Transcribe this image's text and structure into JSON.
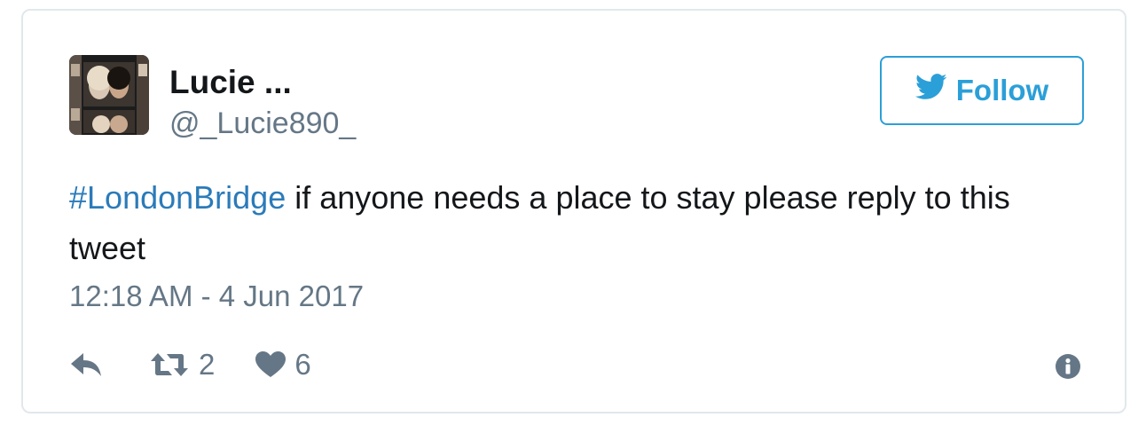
{
  "user": {
    "display_name": "Lucie ...",
    "handle": "@_Lucie890_",
    "avatar_icon": "avatar-photo"
  },
  "follow_button": {
    "label": "Follow",
    "icon": "twitter-bird-icon"
  },
  "tweet": {
    "hashtag": "#LondonBridge",
    "text": " if anyone needs a place to stay please reply to this tweet"
  },
  "timestamp": "12:18 AM - 4 Jun 2017",
  "actions": {
    "reply_icon": "reply-icon",
    "retweet_icon": "retweet-icon",
    "retweet_count": "2",
    "like_icon": "heart-icon",
    "like_count": "6",
    "info_icon": "info-icon"
  },
  "colors": {
    "accent": "#2b9fd8",
    "hashtag": "#2b7bb9",
    "text": "#14171a",
    "muted": "#657786",
    "border": "#e1e8ed"
  }
}
